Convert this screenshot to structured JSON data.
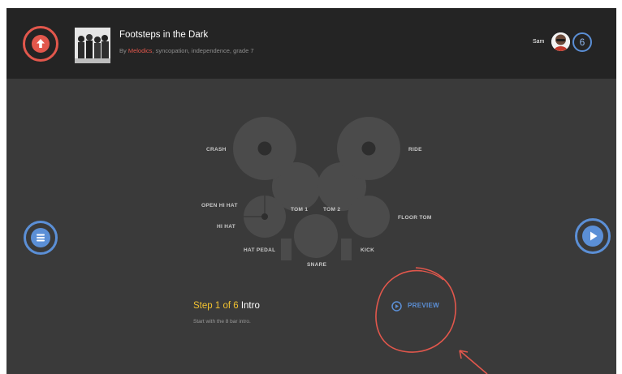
{
  "song": {
    "title": "Footsteps in the Dark",
    "by_prefix": "By ",
    "brand": "Melodics",
    "tags": ", syncopation, independence, grade 7"
  },
  "user": {
    "name": "Sam",
    "level": "6"
  },
  "kit": {
    "crash": "CRASH",
    "ride": "RIDE",
    "open_hi_hat": "OPEN HI HAT",
    "hi_hat": "HI HAT",
    "tom1": "TOM 1",
    "tom2": "TOM 2",
    "floor_tom": "FLOOR TOM",
    "hat_pedal": "HAT PEDAL",
    "snare": "SNARE",
    "kick": "KICK"
  },
  "step": {
    "label": "Step 1 of 6",
    "name": "Intro",
    "description": "Start with the 8 bar intro."
  },
  "preview": {
    "label": "PREVIEW"
  },
  "icons": {
    "back": "arrow-up-icon",
    "menu": "menu-icon",
    "play": "play-icon",
    "preview": "play-circle-icon"
  },
  "colors": {
    "accent_red": "#e2574c",
    "accent_blue": "#5b8fd6",
    "step_yellow": "#f2c230",
    "pad": "#4b4b4b",
    "background": "#3a3a3a",
    "topbar": "#242424"
  }
}
